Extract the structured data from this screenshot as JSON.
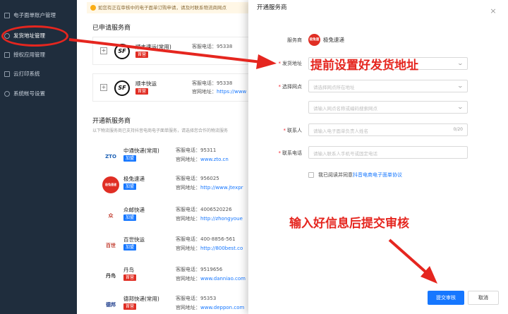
{
  "sidebar": {
    "items": [
      {
        "label": "电子面单账户管理",
        "icon": "calendar-icon"
      },
      {
        "label": "发货地址管理",
        "icon": "location-icon"
      },
      {
        "label": "授权应用管理",
        "icon": "grid-icon"
      },
      {
        "label": "云打印系统",
        "icon": "print-icon"
      },
      {
        "label": "系统帐号设置",
        "icon": "gear-icon"
      }
    ]
  },
  "main": {
    "notice": "如您有正在审核中的电子面单订购申请，请及时联系物流商网点",
    "applied_title": "已申请服务商",
    "applied": [
      {
        "name": "顺丰速运(常用)",
        "tag": "首营",
        "phone_label": "客服电话：",
        "phone": "95338"
      },
      {
        "name": "顺丰快运",
        "tag": "首营",
        "phone_label": "客服电话：",
        "phone": "95338",
        "site_label": "官网地址：",
        "site": "https://www"
      }
    ],
    "new_title": "开通新服务商",
    "new_subtitle": "以下物流服务商已支持抖音电商电子面单服务，请选择您合作的物流服务",
    "providers": [
      {
        "logo": "ZTO",
        "name": "中通快递(常用)",
        "tag": "加盟",
        "phone_label": "客服电话：",
        "phone": "95311",
        "site_label": "官网地址：",
        "site": "www.zto.cn"
      },
      {
        "logo": "极兔速递",
        "name": "极兔速递",
        "tag": "加盟",
        "phone_label": "客服电话：",
        "phone": "956025",
        "site_label": "官网地址：",
        "site": "http://www.jtexpr"
      },
      {
        "logo": "众",
        "name": "众邮快递",
        "tag": "加盟",
        "phone_label": "客服电话：",
        "phone": "4006520226",
        "site_label": "官网地址：",
        "site": "http://zhongyoue"
      },
      {
        "logo": "百世",
        "name": "百世快运",
        "tag": "加盟",
        "phone_label": "客服电话：",
        "phone": "400-8856-561",
        "site_label": "官网地址：",
        "site": "http://800best.co"
      },
      {
        "logo": "丹鸟",
        "name": "丹鸟",
        "tag": "首营",
        "phone_label": "客服电话：",
        "phone": "9519656",
        "site_label": "官网地址：",
        "site": "www.danniao.com"
      },
      {
        "logo": "德邦",
        "name": "德邦快递(常用)",
        "tag": "首营",
        "phone_label": "客服电话：",
        "phone": "95353",
        "site_label": "官网地址：",
        "site": "www.deppon.com"
      }
    ]
  },
  "modal": {
    "title": "开通服务商",
    "close": "×",
    "provider_label": "服务商",
    "provider_logo": "极兔速递",
    "provider_name": "极兔速递",
    "address_label": "发货地址",
    "outlet_label": "选择网点",
    "outlet_placeholder": "请选择网点所在地址",
    "outlet_search_placeholder": "请输入网点名称或编码搜索网点",
    "contact_label": "联系人",
    "contact_placeholder": "请输入电子面单负责人姓名",
    "contact_count": "0/20",
    "phone_label": "联系电话",
    "phone_placeholder": "请输入联系人手机号或固定电话",
    "agree_text": "我已阅读并同意",
    "agree_link": "抖音电商电子面单协议",
    "submit": "提交审核",
    "cancel": "取消"
  },
  "annotations": {
    "top": "提前设置好发货地址",
    "bottom": "输入好信息后提交审核"
  },
  "colors": {
    "accent": "#1677ff",
    "annotation": "#e5261f",
    "sidebar": "#1f2d3d"
  }
}
